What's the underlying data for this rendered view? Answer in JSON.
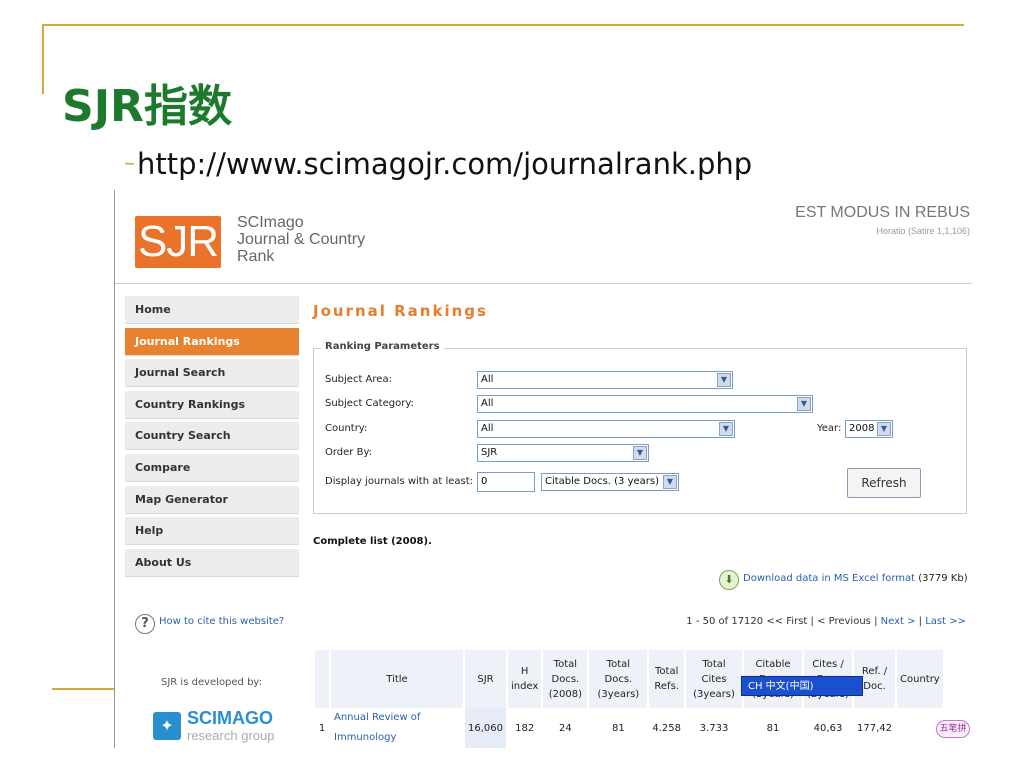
{
  "slide": {
    "title": "SJR指数",
    "bullet_url": "http://www.scimagojr.com/journalrank.php"
  },
  "header": {
    "logo_mark": "SJR",
    "logo_text_1": "SCImago",
    "logo_text_2": "Journal & Country",
    "logo_text_3": "Rank",
    "motto": "EST MODUS IN REBUS",
    "motto_sub": "Horatio (Satire 1,1,106)"
  },
  "nav": {
    "items": [
      "Home",
      "Journal Rankings",
      "Journal Search",
      "Country Rankings",
      "Country Search",
      "Compare",
      "Map Generator",
      "Help",
      "About Us"
    ],
    "active": "Journal Rankings"
  },
  "sidebar": {
    "cite_link": "How to cite this website?",
    "developed_by": "SJR is developed by:",
    "scimago_name": "SCIMAGO",
    "scimago_sub": "research group"
  },
  "main": {
    "title": "Journal Rankings",
    "params_legend": "Ranking Parameters",
    "subject_area_label": "Subject Area:",
    "subject_area_value": "All",
    "subject_category_label": "Subject Category:",
    "subject_category_value": "All",
    "country_label": "Country:",
    "country_value": "All",
    "year_label": "Year:",
    "year_value": "2008",
    "order_by_label": "Order By:",
    "order_by_value": "SJR",
    "display_label": "Display journals with at least:",
    "display_min_value": "0",
    "display_type_value": "Citable Docs. (3 years)",
    "refresh_label": "Refresh",
    "complete_list": "Complete list (2008).",
    "download_label": "Download data in MS Excel format",
    "download_size": "(3779 Kb)",
    "pager_range": "1 - 50 of 17120",
    "pager_first": "<< First",
    "pager_prev": "< Previous",
    "pager_next": "Next >",
    "pager_last": "Last >>"
  },
  "table": {
    "headers": [
      "Title",
      "SJR",
      "H index",
      "Total Docs. (2008)",
      "Total Docs. (3years)",
      "Total Refs.",
      "Total Cites (3years)",
      "Citable Docs. (3years)",
      "Cites / Doc. (2years)",
      "Ref. / Doc.",
      "Country"
    ],
    "rows": [
      {
        "rank": "1",
        "title": "Annual Review of Immunology",
        "sjr": "16,060",
        "h_index": "182",
        "docs_2008": "24",
        "docs_3y": "81",
        "refs": "4.258",
        "cites_3y": "3.733",
        "citable_3y": "81",
        "cites_doc": "40,63",
        "ref_doc": "177,42"
      }
    ]
  },
  "overlay": {
    "ime_bar": "CH 中文(中国)",
    "ime_badge": "五笔拼"
  },
  "colors": {
    "title_green": "#1d7a2c",
    "accent_orange": "#e9822e",
    "deco_gold": "#d2a93f",
    "link_blue": "#2a5fb0"
  }
}
